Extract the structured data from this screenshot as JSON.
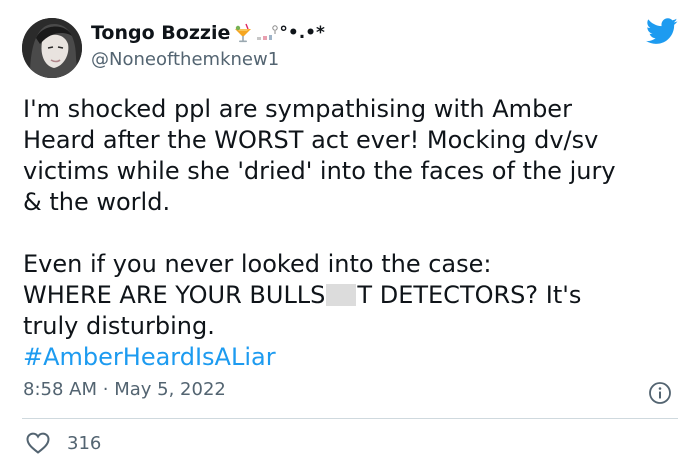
{
  "user": {
    "display_name": "Tongo Bozzie",
    "name_decoration": "°•.•*",
    "handle": "@Noneofthemknew1"
  },
  "icons": {
    "brand": "twitter-bird-icon",
    "avatar": "profile-photo",
    "name_emoji": "tropical-drink-emoji",
    "info": "info-circle-icon",
    "like": "heart-outline-icon"
  },
  "tweet": {
    "lines": [
      "I'm shocked ppl are sympathising with Amber",
      "Heard after the WORST act ever! Mocking dv/sv",
      "victims while she 'dried' into the faces of the jury",
      "& the world.",
      "Even if you never looked into the case:",
      "truly disturbing."
    ],
    "line6_before_censor": "WHERE ARE YOUR BULLS",
    "line6_after_censor": "T DETECTORS?  It's",
    "hashtag": "#AmberHeardIsALiar"
  },
  "meta": {
    "time": "8:58 AM",
    "separator": "·",
    "date": "May 5, 2022"
  },
  "stats": {
    "likes": "316"
  },
  "colors": {
    "brand_blue": "#1d9bf0",
    "text": "#0f1419",
    "muted": "#536471",
    "divider": "#cfd9de",
    "censor_box": "#dcdcdc"
  }
}
